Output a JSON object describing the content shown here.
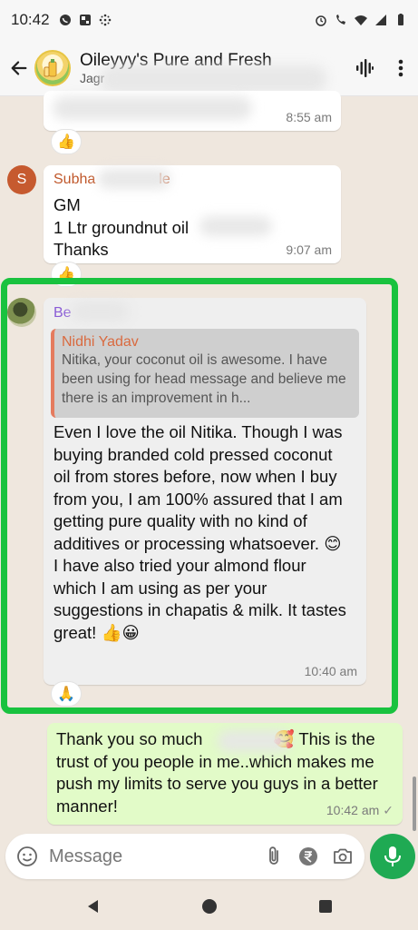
{
  "status_bar": {
    "time": "10:42"
  },
  "header": {
    "title": "Oileyyy's Pure and Fresh",
    "subtitle": "Jagr"
  },
  "messages": [
    {
      "time": "8:55 am",
      "reaction": "👍"
    },
    {
      "sender": "Subha",
      "sender_suffix": "le",
      "avatar_letter": "S",
      "lines": [
        "GM",
        "1 Ltr groundnut oil",
        "Thanks"
      ],
      "time": "9:07 am",
      "reaction": "👍"
    },
    {
      "sender": "Be",
      "quote_name": "Nidhi Yadav",
      "quote_text": "Nitika, your coconut oil is awesome. I have been using for head message and believe me there is an improvement in h...",
      "body_1": "Even I love the oil Nitika. Though I was buying branded cold pressed coconut oil from stores before, now when I buy from you, I am 100% assured that I am getting pure quality with no kind of additives or processing whatsoever. 😊",
      "body_2": "I have also tried your almond flour which I am using as per your suggestions in chapatis & milk. It tastes great! 👍😀",
      "time": "10:40 am",
      "reaction": "🙏"
    },
    {
      "outgoing": true,
      "text_1": "Thank you so much",
      "emoji": "🥰",
      "text_2": "This is the trust of you people in me..which makes me push my limits to serve you guys in a better manner!",
      "time": "10:42 am",
      "tick": "✓"
    }
  ],
  "input": {
    "placeholder": "Message"
  },
  "colors": {
    "highlight": "#19c23f",
    "outgoing_bubble": "#e2fbc8",
    "mic_button": "#1faa53"
  }
}
